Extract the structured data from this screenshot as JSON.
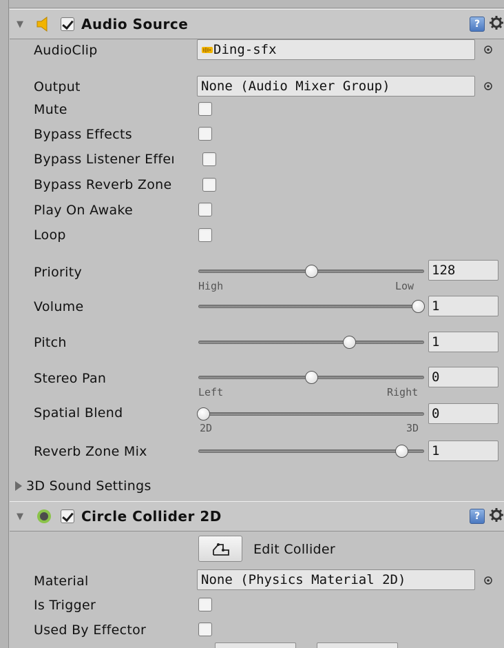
{
  "audio_source": {
    "title": "Audio Source",
    "enabled": true,
    "audio_clip": {
      "label": "AudioClip",
      "value": "Ding-sfx"
    },
    "output": {
      "label": "Output",
      "value": "None (Audio Mixer Group)"
    },
    "toggles": [
      {
        "label": "Mute",
        "checked": false
      },
      {
        "label": "Bypass Effects",
        "checked": false
      },
      {
        "label": "Bypass Listener Effeı",
        "checked": false
      },
      {
        "label": "Bypass Reverb Zone",
        "checked": false
      },
      {
        "label": "Play On Awake",
        "checked": false
      },
      {
        "label": "Loop",
        "checked": false
      }
    ],
    "sliders": [
      {
        "label": "Priority",
        "value": "128",
        "fraction": 0.5,
        "left_caption": "High",
        "right_caption": "Low"
      },
      {
        "label": "Volume",
        "value": "1",
        "fraction": 1.0
      },
      {
        "label": "Pitch",
        "value": "1",
        "fraction": 0.67
      },
      {
        "label": "Stereo Pan",
        "value": "0",
        "fraction": 0.5,
        "left_caption": "Left",
        "right_caption": "Right"
      },
      {
        "label": "Spatial Blend",
        "value": "0",
        "fraction": 0.0,
        "left_caption": "2D",
        "right_caption": "3D"
      },
      {
        "label": "Reverb Zone Mix",
        "value": "1",
        "fraction": 0.9
      }
    ],
    "sound_settings_label": "3D Sound Settings"
  },
  "circle_collider": {
    "title": "Circle Collider 2D",
    "enabled": true,
    "edit_collider_label": "Edit Collider",
    "material": {
      "label": "Material",
      "value": "None (Physics Material 2D)"
    },
    "toggles": [
      {
        "label": "Is Trigger",
        "checked": false
      },
      {
        "label": "Used By Effector",
        "checked": false
      }
    ]
  },
  "colors": {
    "panel_bg": "#c2c2c2",
    "field_bg": "#e6e6e6",
    "audio_icon": "#f2b400",
    "collider_icon": "#8bc34a",
    "help_icon": "#4a78c0"
  },
  "icons": {
    "audio_source": "speaker-icon",
    "collider": "circle-collider-icon",
    "help": "help-book-icon",
    "settings": "gear-icon",
    "object_picker": "object-picker-target-icon",
    "edit_collider": "edit-collider-shape-icon"
  }
}
